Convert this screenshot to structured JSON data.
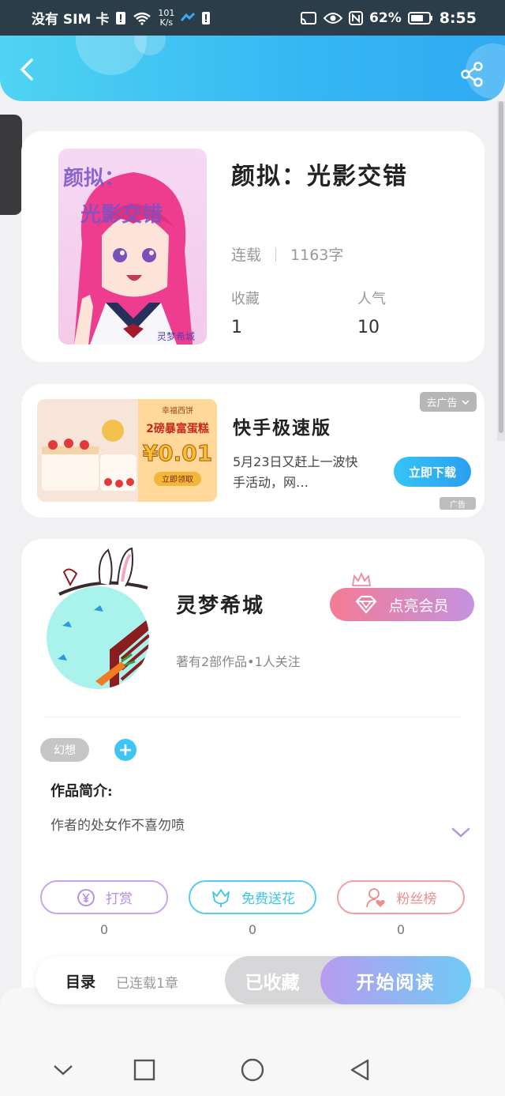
{
  "status_bar": {
    "carrier": "没有 SIM 卡",
    "speed_value": "101",
    "speed_unit": "K/s",
    "battery": "62%",
    "time": "8:55"
  },
  "book": {
    "cover_text_line1": "颜拟：",
    "cover_text_line2": "光影交错",
    "cover_stamp": "灵梦希城",
    "title": "颜拟：光影交错",
    "status": "连载",
    "word_count": "1163字",
    "favorites_label": "收藏",
    "favorites_value": "1",
    "popularity_label": "人气",
    "popularity_value": "10"
  },
  "ad": {
    "remove_label": "去广告",
    "image_banner": "幸福西饼",
    "image_headline": "2磅暴富蛋糕",
    "image_price": "¥0.01",
    "image_cta": "立即领取",
    "title": "快手极速版",
    "description": "5月23日又赶上一波快手活动，网…",
    "download_label": "立即下载",
    "ad_tag": "广告"
  },
  "author": {
    "name": "灵梦希城",
    "subtitle": "著有2部作品•1人关注",
    "vip_label": "点亮会员",
    "genre_tag": "幻想",
    "add_tag_label": "+",
    "intro_title": "作品简介:",
    "intro_text": "作者的处女作不喜勿喷"
  },
  "actions": [
    {
      "label": "打赏",
      "count": "0",
      "color": "#b48be6"
    },
    {
      "label": "免费送花",
      "count": "0",
      "color": "#3cc6ea"
    },
    {
      "label": "粉丝榜",
      "count": "0",
      "color": "#ef8c8c"
    }
  ],
  "bottom_bar": {
    "toc_label": "目录",
    "toc_sub": "已连载1章",
    "collected_label": "已收藏",
    "read_label": "开始阅读"
  },
  "icons": {
    "back": "back-arrow-icon",
    "share": "share-icon",
    "vip": "diamond-icon",
    "crown": "crown-icon",
    "expand": "chevron-down-icon",
    "reward": "yen-icon",
    "flower": "flower-icon",
    "fans": "user-heart-icon"
  }
}
